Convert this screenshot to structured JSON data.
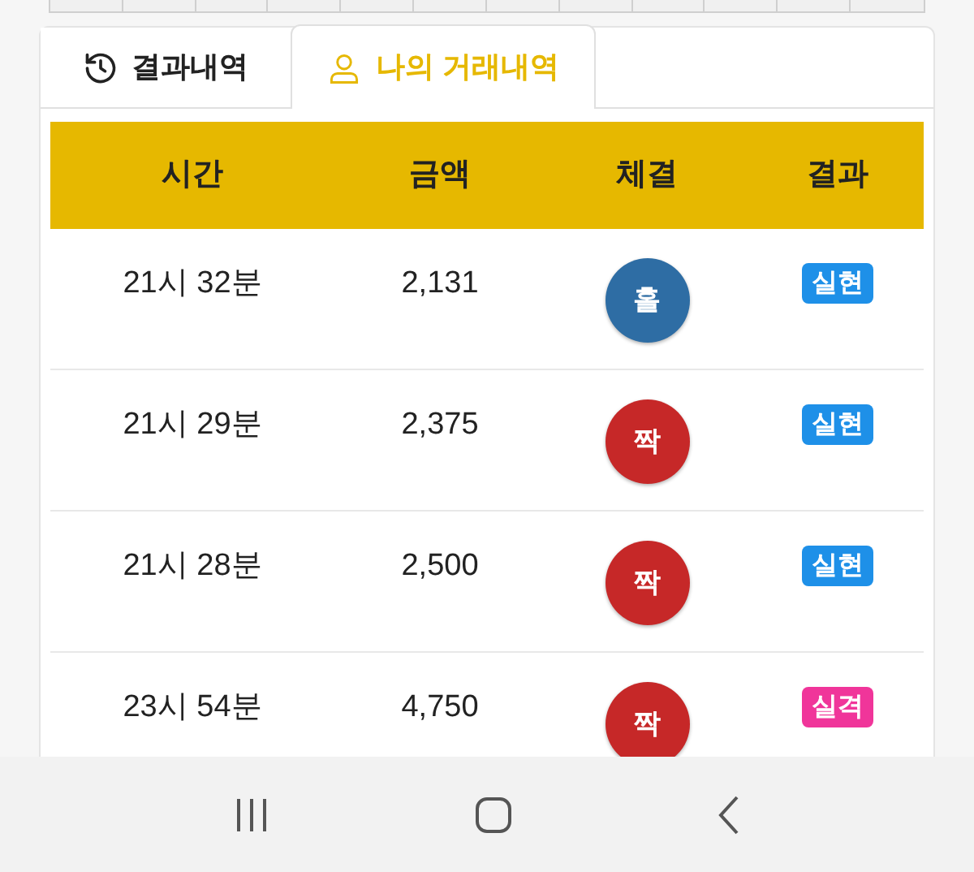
{
  "tabs": [
    {
      "label": "결과내역",
      "kind": "history",
      "selected": false
    },
    {
      "label": "나의 거래내역",
      "kind": "user",
      "selected": true
    }
  ],
  "table": {
    "columns": [
      "시간",
      "금액",
      "체결",
      "결과"
    ],
    "rows": [
      {
        "time": "21시 32분",
        "amount": "2,131",
        "ball": {
          "label": "홀",
          "color": "#2e6da4"
        },
        "result": {
          "label": "실현",
          "color": "#1e90e8"
        }
      },
      {
        "time": "21시 29분",
        "amount": "2,375",
        "ball": {
          "label": "짝",
          "color": "#c62828"
        },
        "result": {
          "label": "실현",
          "color": "#1e90e8"
        }
      },
      {
        "time": "21시 28분",
        "amount": "2,500",
        "ball": {
          "label": "짝",
          "color": "#c62828"
        },
        "result": {
          "label": "실현",
          "color": "#1e90e8"
        }
      },
      {
        "time": "23시 54분",
        "amount": "4,750",
        "ball": {
          "label": "짝",
          "color": "#c62828"
        },
        "result": {
          "label": "실격",
          "color": "#f0359a"
        }
      }
    ]
  }
}
